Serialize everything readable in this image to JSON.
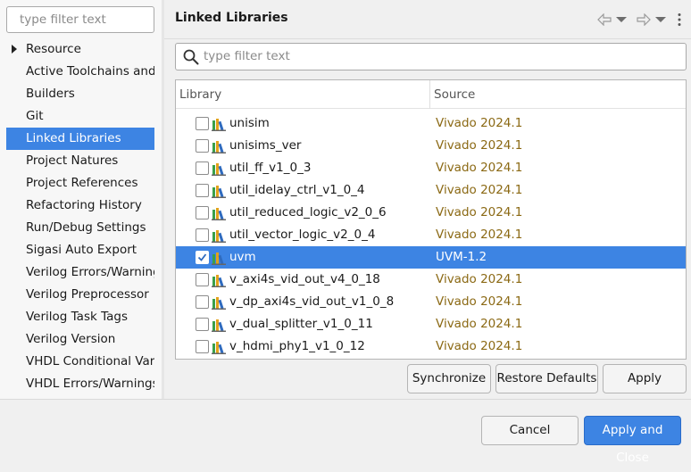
{
  "sidebar": {
    "filter_placeholder": "type filter text",
    "items": [
      {
        "label": "Resource",
        "expandable": true
      },
      {
        "label": "Active Toolchains and Li"
      },
      {
        "label": "Builders"
      },
      {
        "label": "Git"
      },
      {
        "label": "Linked Libraries",
        "selected": true
      },
      {
        "label": "Project Natures"
      },
      {
        "label": "Project References"
      },
      {
        "label": "Refactoring History"
      },
      {
        "label": "Run/Debug Settings"
      },
      {
        "label": "Sigasi Auto Export"
      },
      {
        "label": "Verilog Errors/Warnings"
      },
      {
        "label": "Verilog Preprocessor"
      },
      {
        "label": "Verilog Task Tags"
      },
      {
        "label": "Verilog Version"
      },
      {
        "label": "VHDL Conditional Variat"
      },
      {
        "label": "VHDL Errors/Warnings"
      }
    ]
  },
  "page": {
    "title": "Linked Libraries",
    "filter_placeholder": "type filter text",
    "icons": [
      "back-arrow-icon",
      "back-dropdown-icon",
      "forward-arrow-icon",
      "forward-dropdown-icon",
      "kebab-menu-icon"
    ]
  },
  "table": {
    "columns": {
      "library": "Library",
      "source": "Source"
    },
    "rows": [
      {
        "library": "unisim",
        "source": "Vivado 2024.1",
        "checked": false
      },
      {
        "library": "unisims_ver",
        "source": "Vivado 2024.1",
        "checked": false
      },
      {
        "library": "util_ff_v1_0_3",
        "source": "Vivado 2024.1",
        "checked": false
      },
      {
        "library": "util_idelay_ctrl_v1_0_4",
        "source": "Vivado 2024.1",
        "checked": false
      },
      {
        "library": "util_reduced_logic_v2_0_6",
        "source": "Vivado 2024.1",
        "checked": false
      },
      {
        "library": "util_vector_logic_v2_0_4",
        "source": "Vivado 2024.1",
        "checked": false
      },
      {
        "library": "uvm",
        "source": "UVM-1.2",
        "checked": true,
        "selected": true
      },
      {
        "library": "v_axi4s_vid_out_v4_0_18",
        "source": "Vivado 2024.1",
        "checked": false
      },
      {
        "library": "v_dp_axi4s_vid_out_v1_0_8",
        "source": "Vivado 2024.1",
        "checked": false
      },
      {
        "library": "v_dual_splitter_v1_0_11",
        "source": "Vivado 2024.1",
        "checked": false
      },
      {
        "library": "v_hdmi_phy1_v1_0_12",
        "source": "Vivado 2024.1",
        "checked": false
      }
    ]
  },
  "buttons": {
    "synchronize": "Synchronize",
    "restore_defaults": "Restore Defaults",
    "apply": "Apply",
    "cancel": "Cancel",
    "apply_and_close": "Apply and Close"
  },
  "colors": {
    "accent": "#3d84e3",
    "source_text": "#8b6914",
    "library_icon": [
      "#3aa04a",
      "#e3a21a",
      "#2f6bbf"
    ]
  }
}
